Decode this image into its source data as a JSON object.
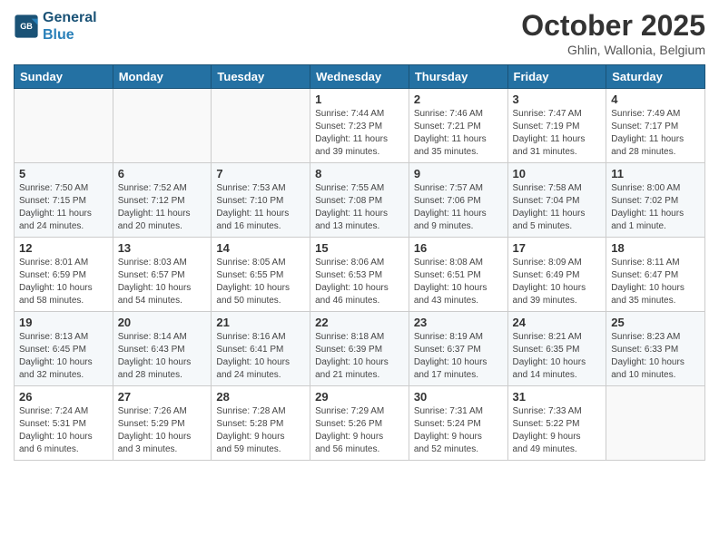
{
  "header": {
    "logo_line1": "General",
    "logo_line2": "Blue",
    "month": "October 2025",
    "location": "Ghlin, Wallonia, Belgium"
  },
  "weekdays": [
    "Sunday",
    "Monday",
    "Tuesday",
    "Wednesday",
    "Thursday",
    "Friday",
    "Saturday"
  ],
  "weeks": [
    [
      {
        "day": "",
        "info": ""
      },
      {
        "day": "",
        "info": ""
      },
      {
        "day": "",
        "info": ""
      },
      {
        "day": "1",
        "info": "Sunrise: 7:44 AM\nSunset: 7:23 PM\nDaylight: 11 hours\nand 39 minutes."
      },
      {
        "day": "2",
        "info": "Sunrise: 7:46 AM\nSunset: 7:21 PM\nDaylight: 11 hours\nand 35 minutes."
      },
      {
        "day": "3",
        "info": "Sunrise: 7:47 AM\nSunset: 7:19 PM\nDaylight: 11 hours\nand 31 minutes."
      },
      {
        "day": "4",
        "info": "Sunrise: 7:49 AM\nSunset: 7:17 PM\nDaylight: 11 hours\nand 28 minutes."
      }
    ],
    [
      {
        "day": "5",
        "info": "Sunrise: 7:50 AM\nSunset: 7:15 PM\nDaylight: 11 hours\nand 24 minutes."
      },
      {
        "day": "6",
        "info": "Sunrise: 7:52 AM\nSunset: 7:12 PM\nDaylight: 11 hours\nand 20 minutes."
      },
      {
        "day": "7",
        "info": "Sunrise: 7:53 AM\nSunset: 7:10 PM\nDaylight: 11 hours\nand 16 minutes."
      },
      {
        "day": "8",
        "info": "Sunrise: 7:55 AM\nSunset: 7:08 PM\nDaylight: 11 hours\nand 13 minutes."
      },
      {
        "day": "9",
        "info": "Sunrise: 7:57 AM\nSunset: 7:06 PM\nDaylight: 11 hours\nand 9 minutes."
      },
      {
        "day": "10",
        "info": "Sunrise: 7:58 AM\nSunset: 7:04 PM\nDaylight: 11 hours\nand 5 minutes."
      },
      {
        "day": "11",
        "info": "Sunrise: 8:00 AM\nSunset: 7:02 PM\nDaylight: 11 hours\nand 1 minute."
      }
    ],
    [
      {
        "day": "12",
        "info": "Sunrise: 8:01 AM\nSunset: 6:59 PM\nDaylight: 10 hours\nand 58 minutes."
      },
      {
        "day": "13",
        "info": "Sunrise: 8:03 AM\nSunset: 6:57 PM\nDaylight: 10 hours\nand 54 minutes."
      },
      {
        "day": "14",
        "info": "Sunrise: 8:05 AM\nSunset: 6:55 PM\nDaylight: 10 hours\nand 50 minutes."
      },
      {
        "day": "15",
        "info": "Sunrise: 8:06 AM\nSunset: 6:53 PM\nDaylight: 10 hours\nand 46 minutes."
      },
      {
        "day": "16",
        "info": "Sunrise: 8:08 AM\nSunset: 6:51 PM\nDaylight: 10 hours\nand 43 minutes."
      },
      {
        "day": "17",
        "info": "Sunrise: 8:09 AM\nSunset: 6:49 PM\nDaylight: 10 hours\nand 39 minutes."
      },
      {
        "day": "18",
        "info": "Sunrise: 8:11 AM\nSunset: 6:47 PM\nDaylight: 10 hours\nand 35 minutes."
      }
    ],
    [
      {
        "day": "19",
        "info": "Sunrise: 8:13 AM\nSunset: 6:45 PM\nDaylight: 10 hours\nand 32 minutes."
      },
      {
        "day": "20",
        "info": "Sunrise: 8:14 AM\nSunset: 6:43 PM\nDaylight: 10 hours\nand 28 minutes."
      },
      {
        "day": "21",
        "info": "Sunrise: 8:16 AM\nSunset: 6:41 PM\nDaylight: 10 hours\nand 24 minutes."
      },
      {
        "day": "22",
        "info": "Sunrise: 8:18 AM\nSunset: 6:39 PM\nDaylight: 10 hours\nand 21 minutes."
      },
      {
        "day": "23",
        "info": "Sunrise: 8:19 AM\nSunset: 6:37 PM\nDaylight: 10 hours\nand 17 minutes."
      },
      {
        "day": "24",
        "info": "Sunrise: 8:21 AM\nSunset: 6:35 PM\nDaylight: 10 hours\nand 14 minutes."
      },
      {
        "day": "25",
        "info": "Sunrise: 8:23 AM\nSunset: 6:33 PM\nDaylight: 10 hours\nand 10 minutes."
      }
    ],
    [
      {
        "day": "26",
        "info": "Sunrise: 7:24 AM\nSunset: 5:31 PM\nDaylight: 10 hours\nand 6 minutes."
      },
      {
        "day": "27",
        "info": "Sunrise: 7:26 AM\nSunset: 5:29 PM\nDaylight: 10 hours\nand 3 minutes."
      },
      {
        "day": "28",
        "info": "Sunrise: 7:28 AM\nSunset: 5:28 PM\nDaylight: 9 hours\nand 59 minutes."
      },
      {
        "day": "29",
        "info": "Sunrise: 7:29 AM\nSunset: 5:26 PM\nDaylight: 9 hours\nand 56 minutes."
      },
      {
        "day": "30",
        "info": "Sunrise: 7:31 AM\nSunset: 5:24 PM\nDaylight: 9 hours\nand 52 minutes."
      },
      {
        "day": "31",
        "info": "Sunrise: 7:33 AM\nSunset: 5:22 PM\nDaylight: 9 hours\nand 49 minutes."
      },
      {
        "day": "",
        "info": ""
      }
    ]
  ]
}
